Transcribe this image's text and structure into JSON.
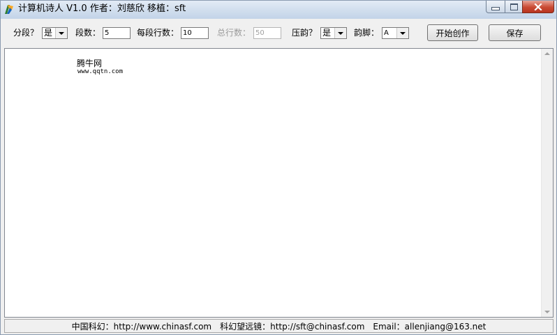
{
  "window": {
    "title": "计算机诗人 V1.0 作者：刘慈欣 移植：sft"
  },
  "toolbar": {
    "segment_label": "分段？",
    "segment_value": "是",
    "segments_label": "段数：",
    "segments_value": "5",
    "lines_per_segment_label": "每段行数：",
    "lines_per_segment_value": "10",
    "total_lines_label": "总行数：",
    "total_lines_value": "50",
    "rhyme_label": "压韵？",
    "rhyme_value": "是",
    "rhyme_foot_label": "韵脚：",
    "rhyme_foot_value": "A",
    "start_button": "开始创作",
    "save_button": "保存"
  },
  "content": {
    "watermark_title": "腾牛网",
    "watermark_url": "www.qqtn.com"
  },
  "footer": {
    "link1": "中国科幻：http://www.chinasf.com",
    "link2": "科幻望远镜：http://sft@chinasf.com",
    "link3": "Email：allenjiang@163.net"
  },
  "colors": {
    "title_bar": "#d2dfee",
    "close_button": "#c94a33",
    "window_bg": "#f0f0f0"
  }
}
